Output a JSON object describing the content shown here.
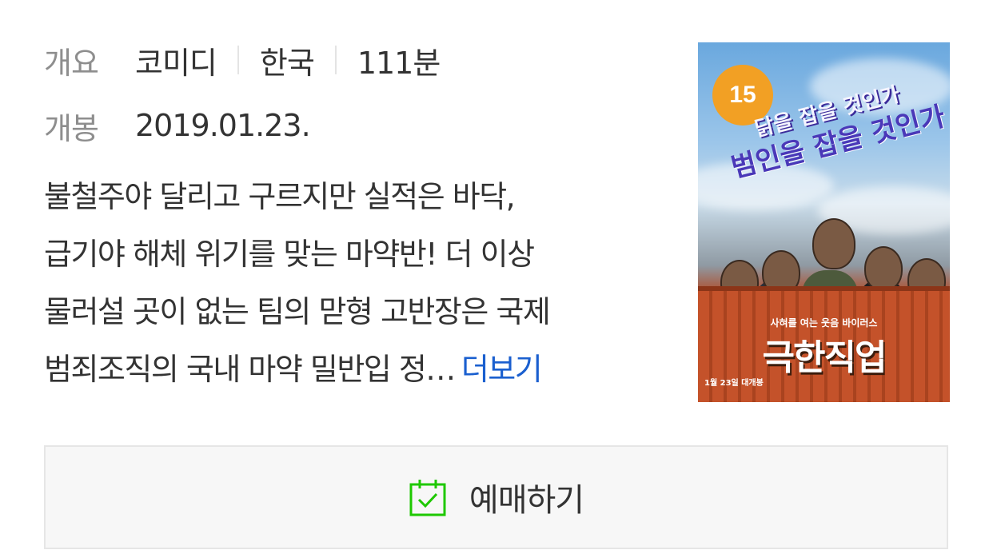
{
  "overview": {
    "label": "개요",
    "genre": "코미디",
    "country": "한국",
    "runtime": "111분"
  },
  "release": {
    "label": "개봉",
    "date": "2019.01.23."
  },
  "synopsis": {
    "lines": [
      "불철주야 달리고 구르지만 실적은 바닥,",
      "급기야 해체 위기를 맞는 마약반! 더 이상",
      "물러설 곳이 없는 팀의 맏형 고반장은 국제",
      "범죄조직의 국내 마약 밀반입 정…"
    ],
    "more_label": "더보기"
  },
  "poster": {
    "rating": "15",
    "tagline_1": "닭을 잡을 것인가",
    "tagline_2": "범인을 잡을 것인가",
    "subtitle": "사혀를 여는 웃음 바이러스",
    "title": "극한직업",
    "release_note": "1월 23일 대개봉"
  },
  "reserve": {
    "label": "예매하기",
    "icon": "calendar-check-icon",
    "icon_color": "#1ec800"
  },
  "colors": {
    "label_gray": "#8e8e8e",
    "text": "#333333",
    "link_blue": "#1a5fcf",
    "button_bg": "#f7f7f7",
    "button_border": "#e6e6e6"
  }
}
